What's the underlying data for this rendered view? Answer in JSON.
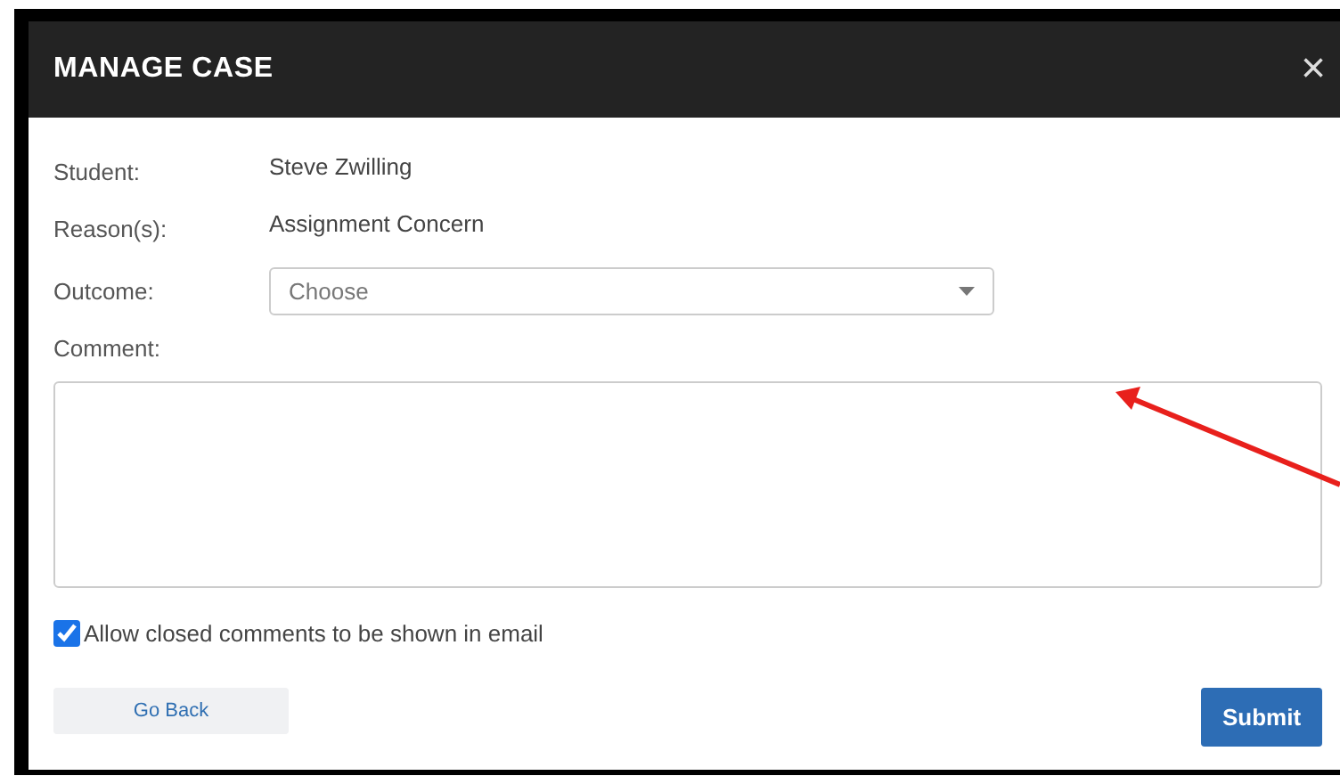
{
  "dialog": {
    "title": "MANAGE CASE",
    "close": "×"
  },
  "fields": [
    {
      "label": "Student:",
      "value": "Steve Zwilling"
    },
    {
      "label": "Reason(s):",
      "value": "Assignment Concern"
    }
  ],
  "outcome": {
    "label": "Outcome:",
    "placeholder": "Choose"
  },
  "comment": {
    "label": "Comment:"
  },
  "email_option": {
    "label": "Allow closed comments to be shown in email",
    "checked": true
  },
  "buttons": {
    "back": "Go Back",
    "submit": "Submit"
  }
}
